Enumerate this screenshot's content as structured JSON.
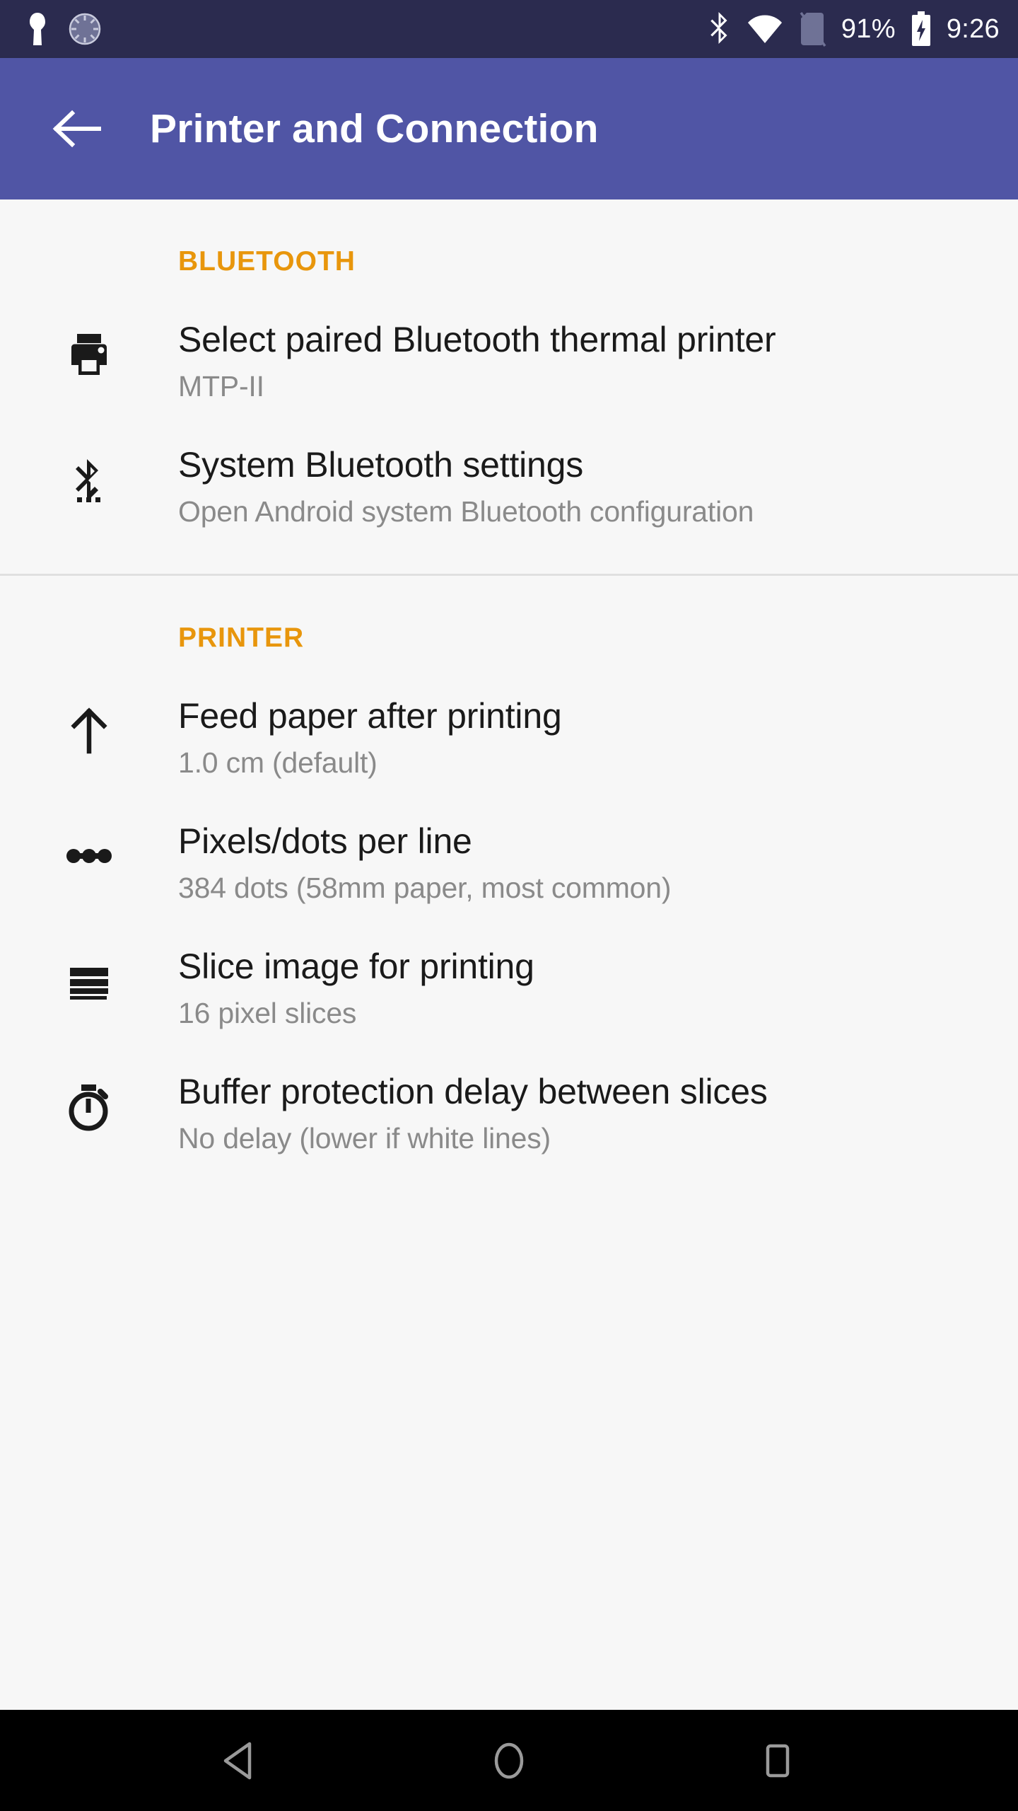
{
  "status_bar": {
    "background": "#2b2b4f",
    "left_icons": [
      {
        "name": "keyhole-notification-icon",
        "label": "keyhole"
      },
      {
        "name": "dimmed-circle-notification-icon",
        "label": "circle-dashed"
      }
    ],
    "right_icons": [
      {
        "name": "bluetooth-icon",
        "label": "bluetooth"
      },
      {
        "name": "wifi-icon",
        "label": "wifi-full"
      },
      {
        "name": "no-sim-icon",
        "label": "no-sim"
      }
    ],
    "battery_percent": "91%",
    "battery_state": "charging",
    "clock": "9:26"
  },
  "app_bar": {
    "background": "#5055a5",
    "back_icon": "arrow-back",
    "title": "Printer and Connection"
  },
  "sections": [
    {
      "header": "BLUETOOTH",
      "header_color": "#e8960c",
      "items": [
        {
          "icon": "printer-icon",
          "title": "Select paired Bluetooth thermal printer",
          "summary": "MTP-II"
        },
        {
          "icon": "bluetooth-settings-icon",
          "title": "System Bluetooth settings",
          "summary": "Open Android system Bluetooth configuration"
        }
      ]
    },
    {
      "header": "PRINTER",
      "header_color": "#e8960c",
      "items": [
        {
          "icon": "arrow-up-icon",
          "title": "Feed paper after printing",
          "summary": "1.0 cm (default)"
        },
        {
          "icon": "dots-per-line-icon",
          "title": "Pixels/dots per line",
          "summary": "384 dots (58mm paper, most common)"
        },
        {
          "icon": "slices-icon",
          "title": "Slice image for printing",
          "summary": "16 pixel slices"
        },
        {
          "icon": "stopwatch-icon",
          "title": "Buffer protection delay between slices",
          "summary": "No delay (lower if white lines)"
        }
      ]
    }
  ],
  "nav_bar": {
    "background": "#000000",
    "buttons": [
      {
        "name": "nav-back-button",
        "label": "Back"
      },
      {
        "name": "nav-home-button",
        "label": "Home"
      },
      {
        "name": "nav-recents-button",
        "label": "Recents"
      }
    ]
  }
}
